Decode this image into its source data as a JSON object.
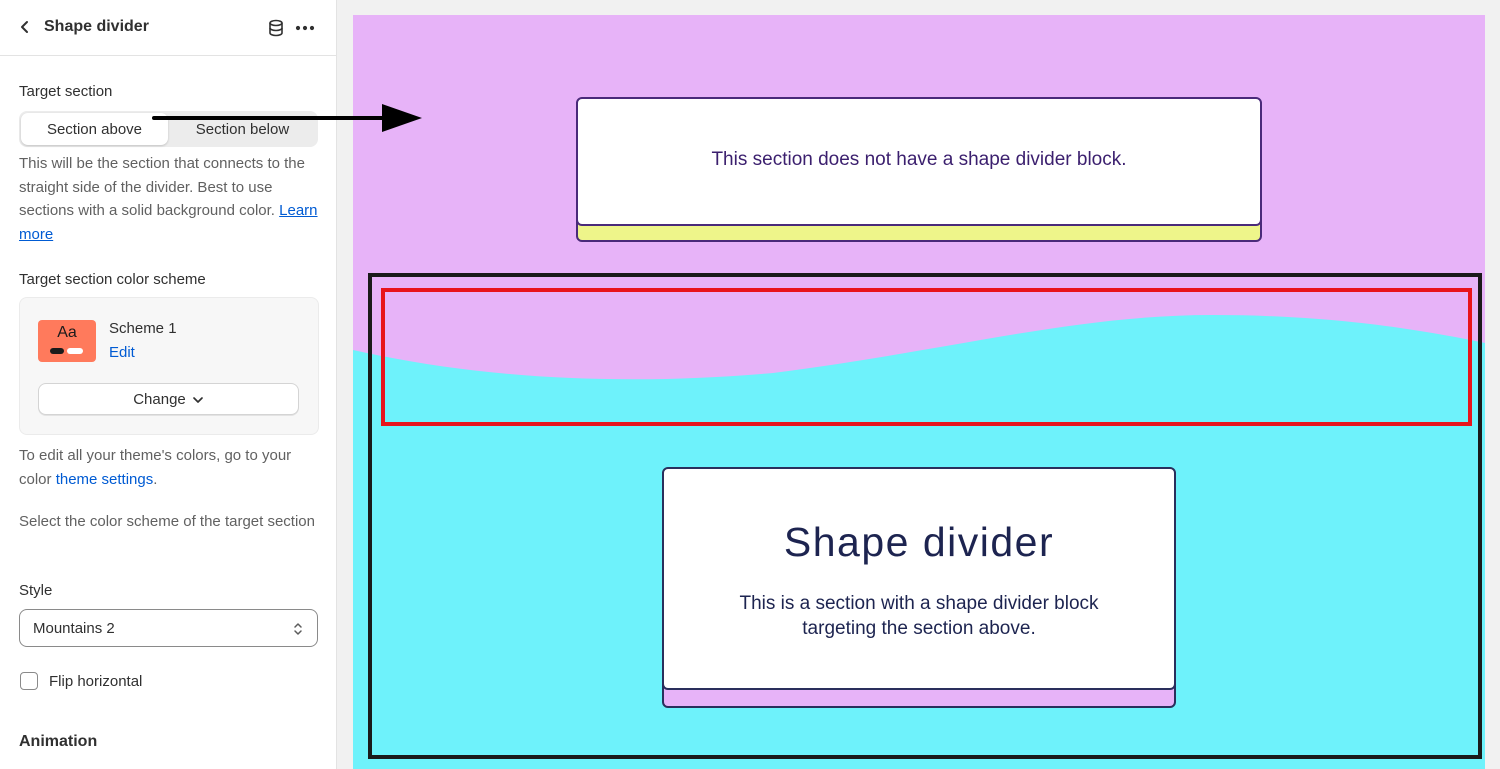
{
  "sidebar": {
    "title": "Shape divider",
    "icons": {
      "back": "chevron-left-icon",
      "database": "database-icon",
      "more": "more-horizontal-icon"
    },
    "target_section": {
      "label": "Target section",
      "options": [
        "Section above",
        "Section below"
      ],
      "selected": "Section above",
      "help_text": "This will be the section that connects to the straight side of the divider. Best to use sections with a solid background color.",
      "help_link": "Learn more"
    },
    "color_scheme": {
      "label": "Target section color scheme",
      "swatch_text": "Aa",
      "swatch_color": "#ff7a5c",
      "scheme_name": "Scheme 1",
      "edit_label": "Edit",
      "change_label": "Change",
      "help_prefix": "To edit all your theme's colors, go to your color",
      "help_link": "theme settings",
      "help_suffix": ".",
      "description": "Select the color scheme of the target section"
    },
    "style": {
      "label": "Style",
      "value": "Mountains 2"
    },
    "flip": {
      "label": "Flip horizontal",
      "checked": false
    },
    "animation_heading": "Animation"
  },
  "preview": {
    "colors": {
      "top_section": "#e7b3f8",
      "bottom_section": "#6ef2fb",
      "accent_yellow": "#eef58a",
      "frame": "#1a1a1a",
      "highlight": "#e8141b"
    },
    "top_card_text": "This section does not have a shape divider block.",
    "bottom_card_title": "Shape divider",
    "bottom_card_body": "This is a section with a shape divider block targeting the section above."
  }
}
